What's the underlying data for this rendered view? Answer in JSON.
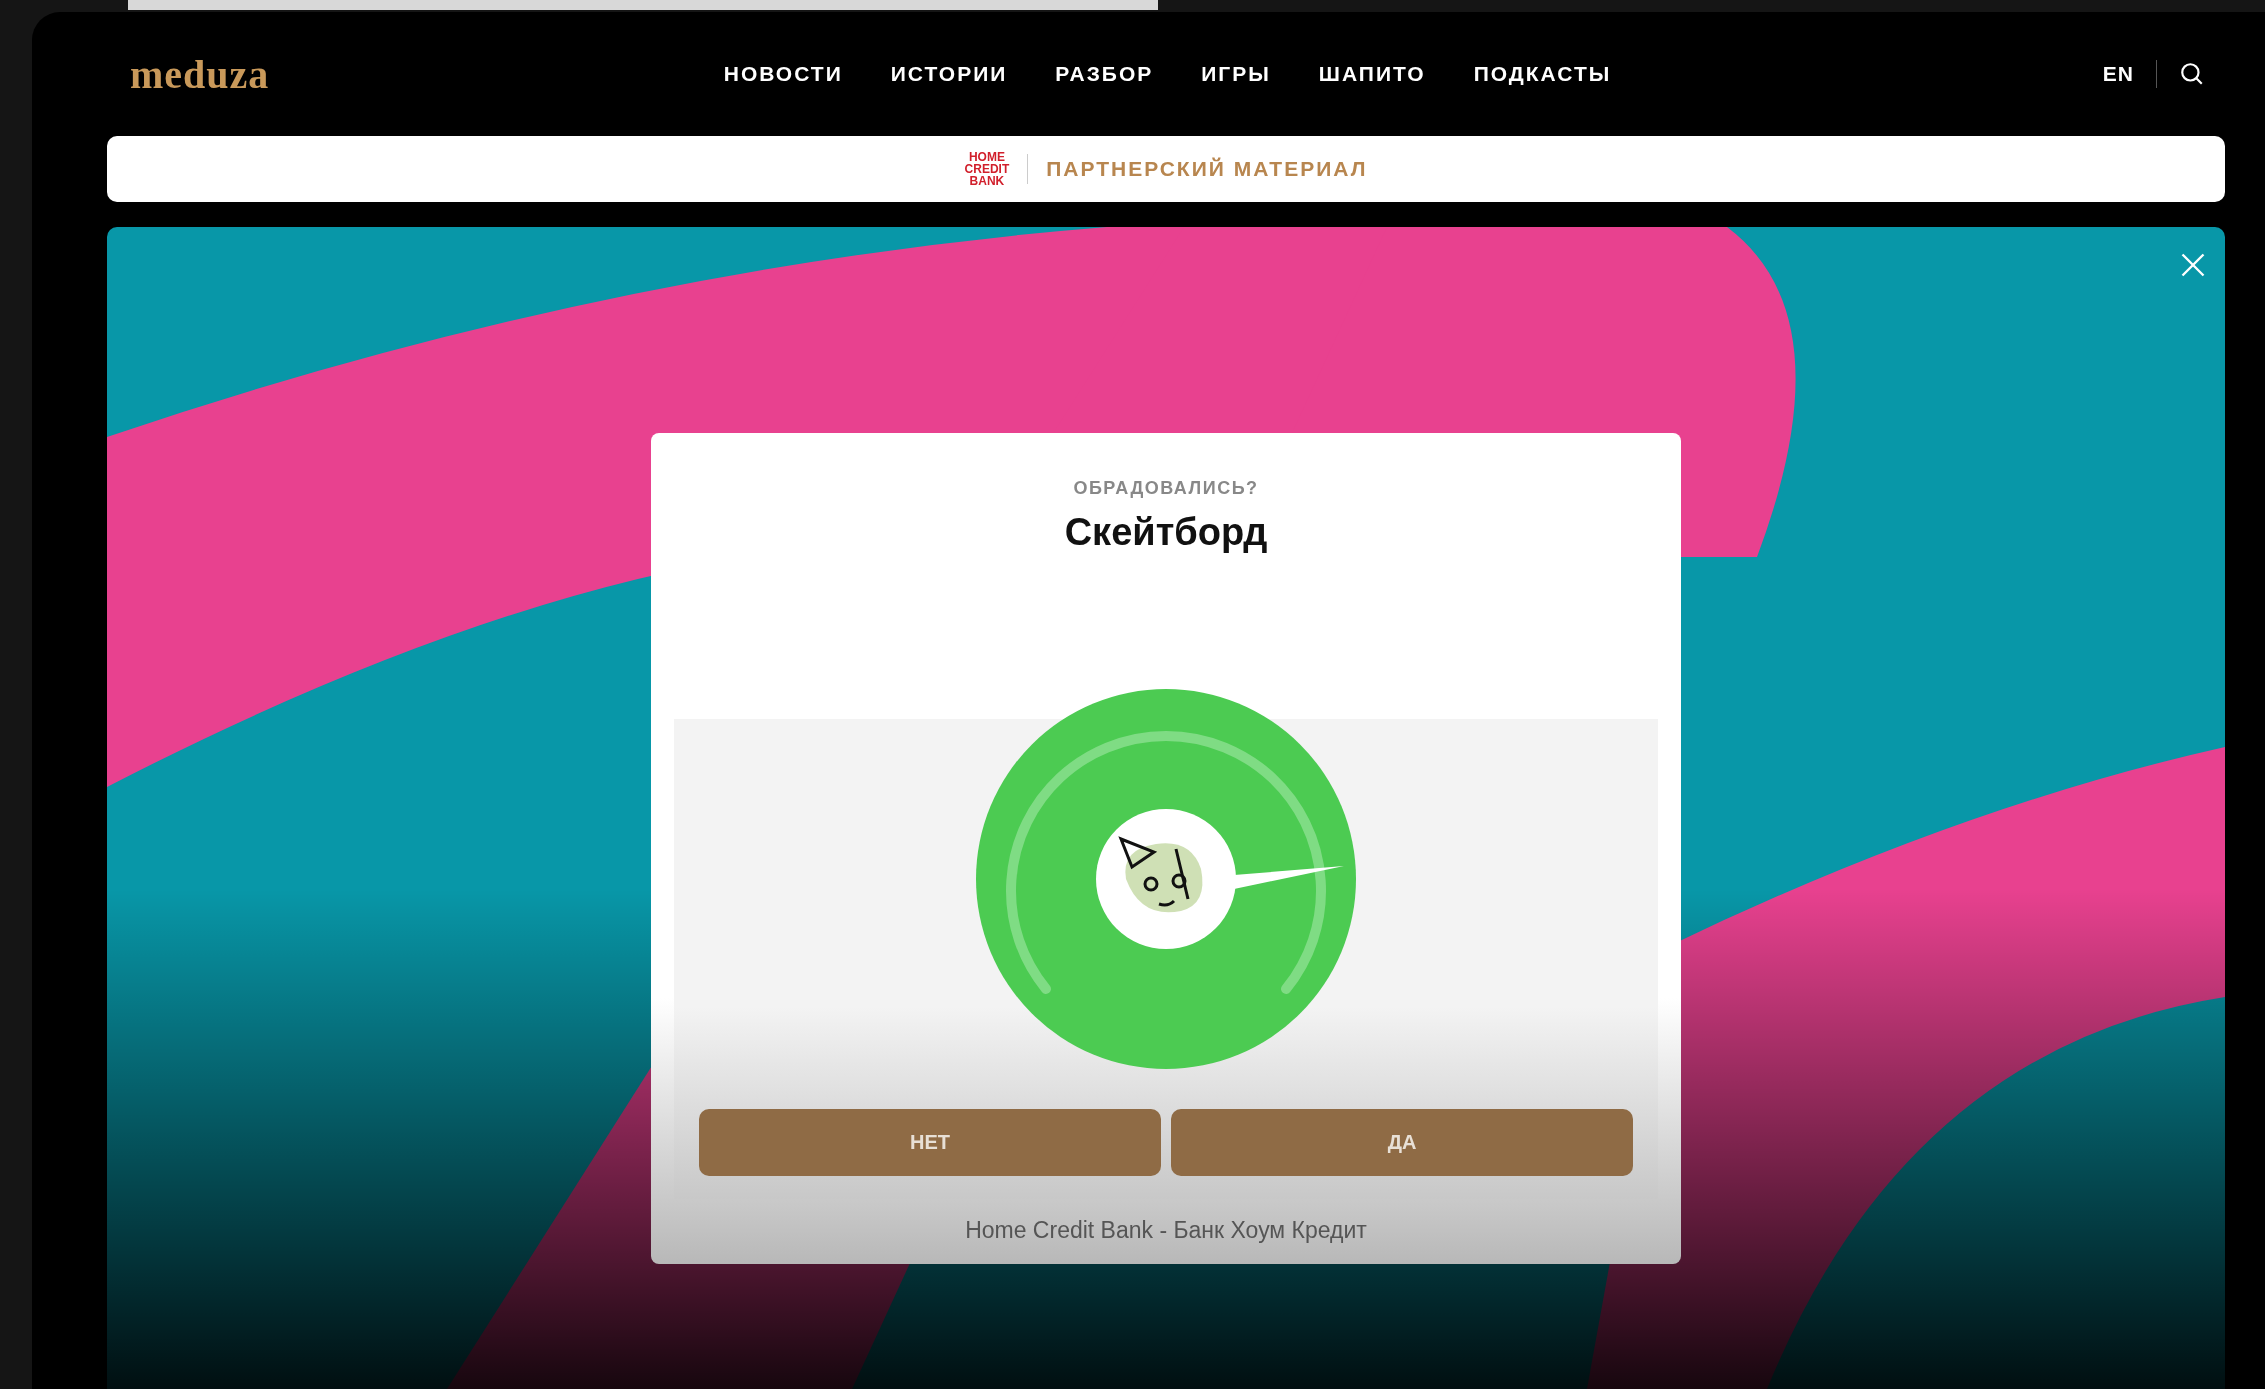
{
  "header": {
    "logo": "meduza",
    "nav": [
      "НОВОСТИ",
      "ИСТОРИИ",
      "РАЗБОР",
      "ИГРЫ",
      "ШАПИТО",
      "ПОДКАСТЫ"
    ],
    "language": "EN"
  },
  "partner_bar": {
    "sponsor_logo": "HOME CREDIT BANK",
    "label": "ПАРТНЕРСКИЙ МАТЕРИАЛ"
  },
  "quiz": {
    "question": "ОБРАДОВАЛИСЬ?",
    "item": "Скейтборд",
    "buttons": [
      "НЕТ",
      "ДА"
    ],
    "sponsor": "Home Credit Bank - Банк Хоум Кредит"
  }
}
